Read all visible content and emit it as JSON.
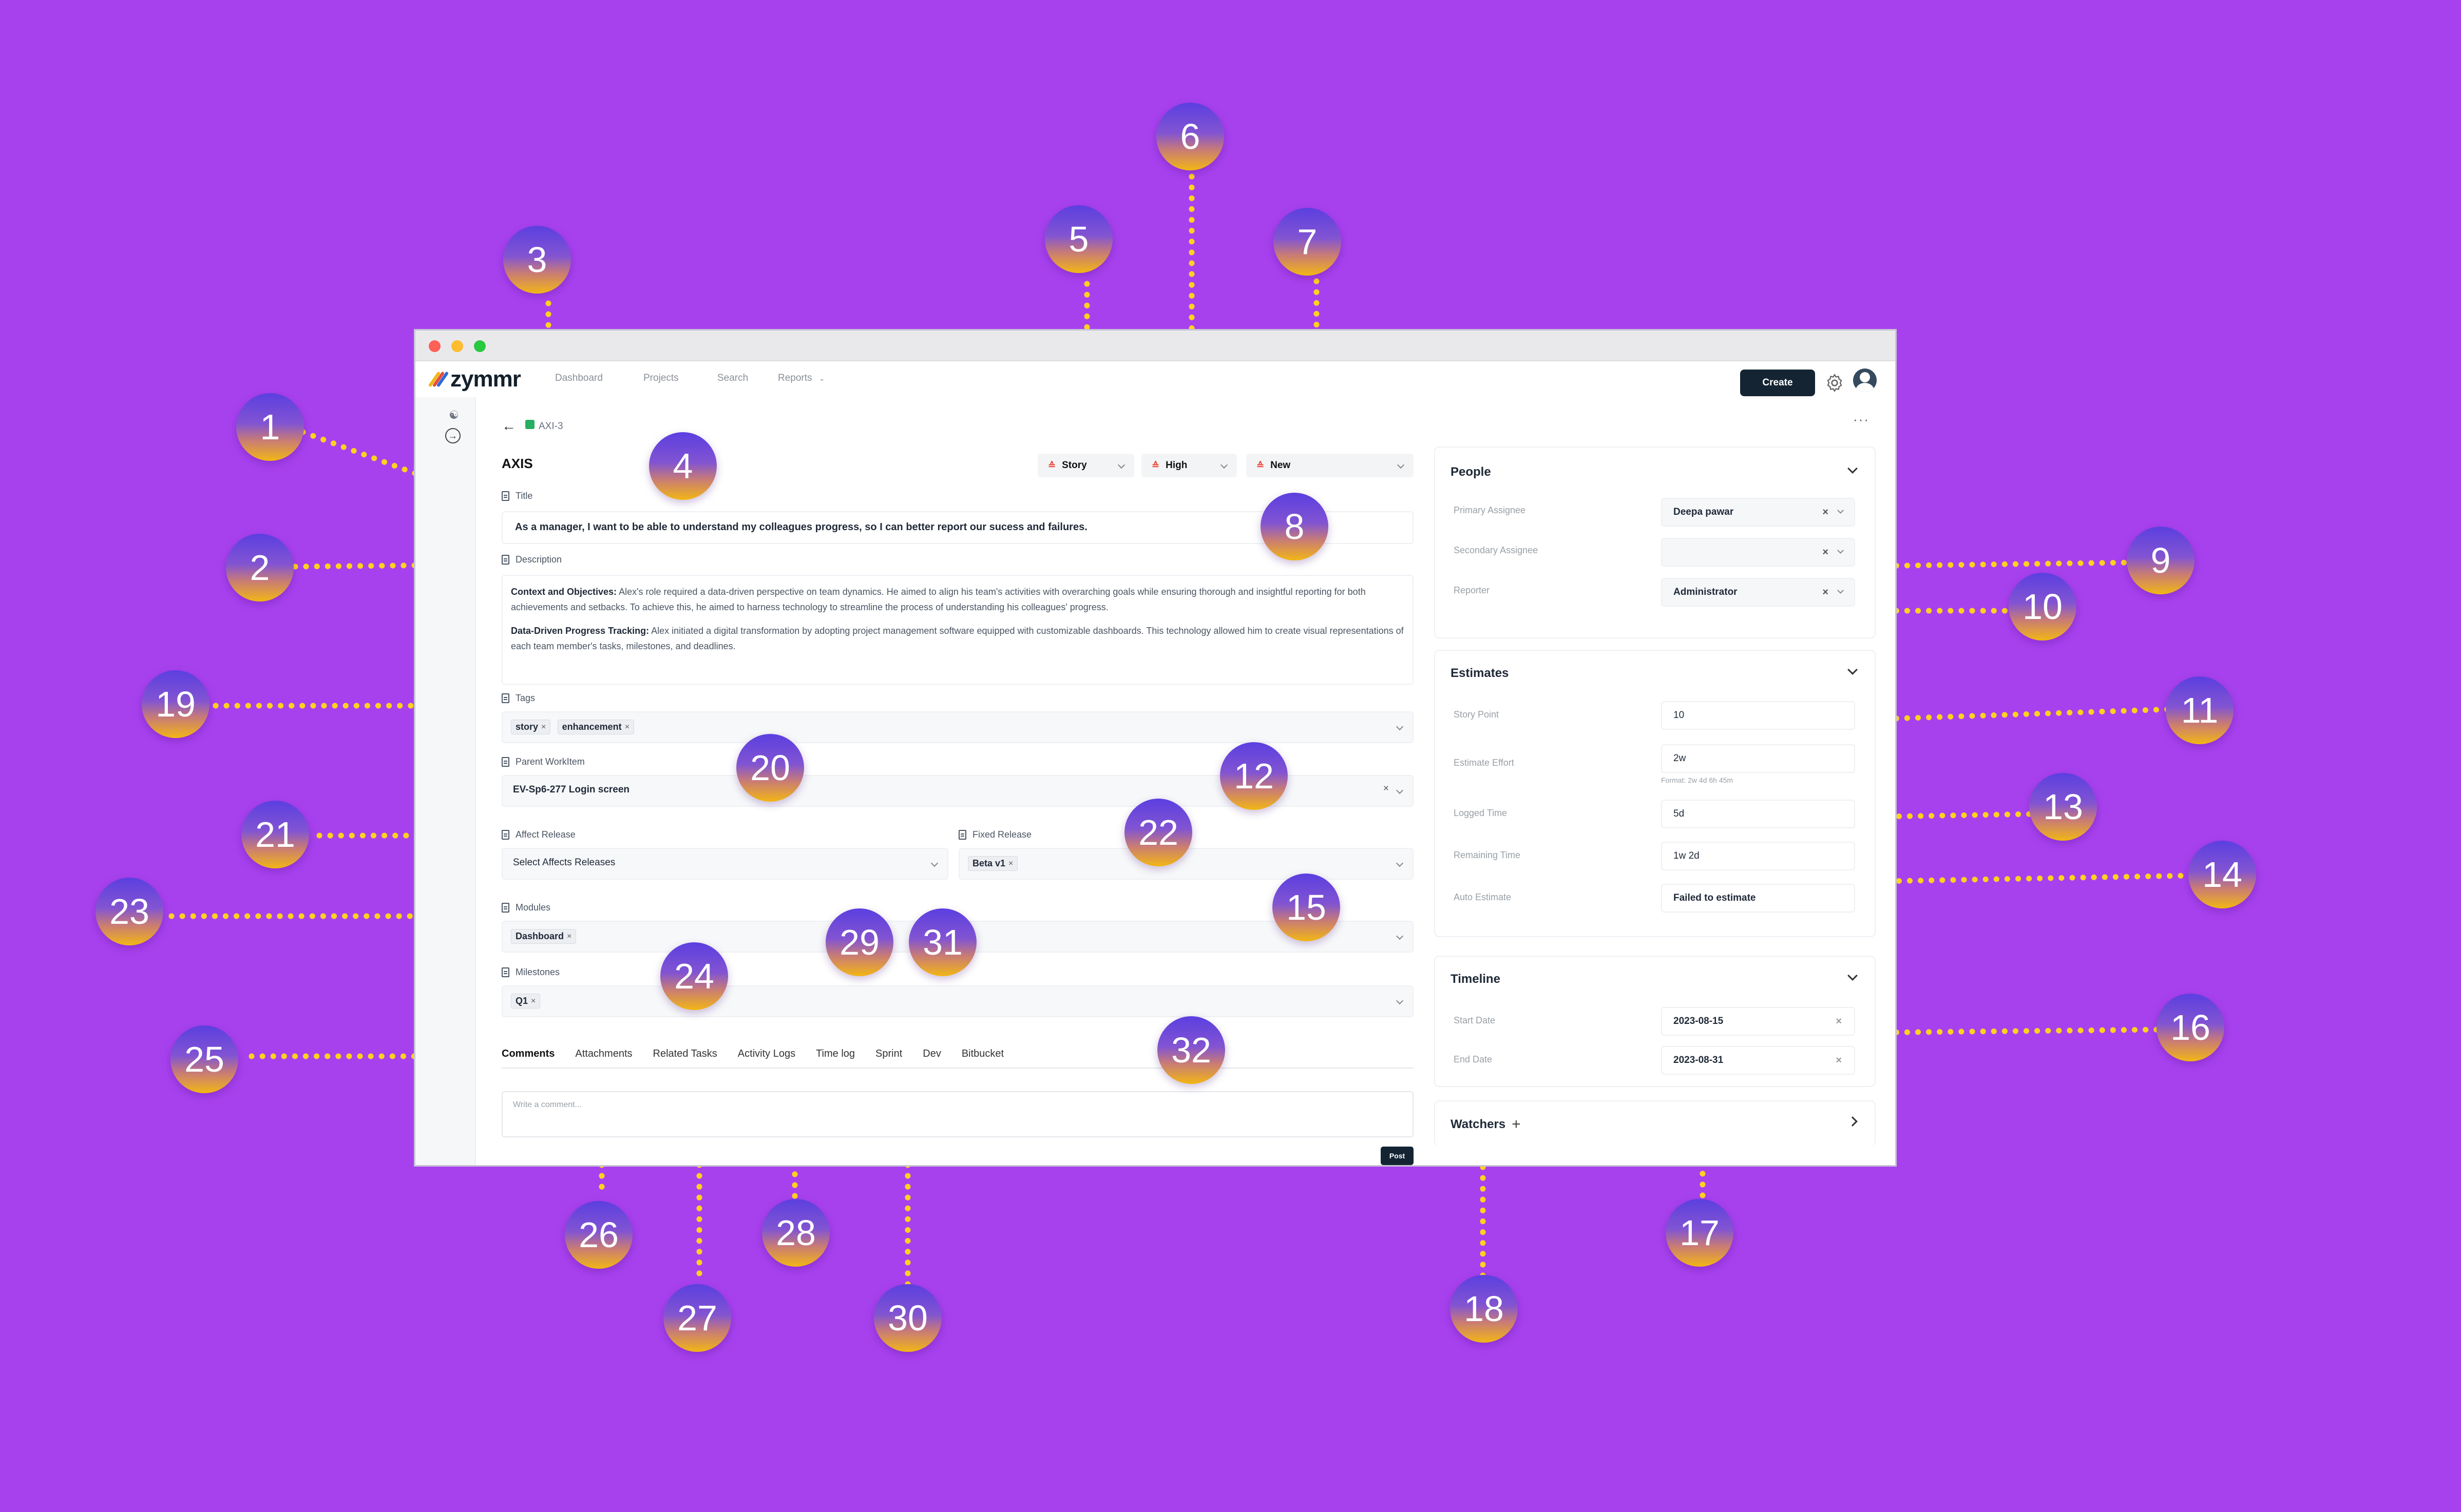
{
  "app": {
    "logo_text": "zymmr",
    "nav": [
      "Dashboard",
      "Projects",
      "Search",
      "Reports"
    ],
    "create_label": "Create"
  },
  "breadcrumb": {
    "item_id": "AXI-3"
  },
  "issue": {
    "project_name": "AXIS",
    "type": "Story",
    "priority": "High",
    "status": "New",
    "labels": {
      "title": "Title",
      "description": "Description",
      "tags": "Tags",
      "parent": "Parent WorkItem",
      "affect_release": "Affect Release",
      "fixed_release": "Fixed Release",
      "modules": "Modules",
      "milestones": "Milestones"
    },
    "title": "As a manager, I want to be able to understand my colleagues progress, so I can better report our sucess and failures.",
    "description": {
      "p1_head": "Context and Objectives:",
      "p1_body": "Alex's role required a data-driven perspective on team dynamics. He aimed to align his team's activities with overarching goals while ensuring thorough and insightful reporting for both achievements and setbacks. To achieve this, he aimed to harness technology to streamline the process of understanding his colleagues' progress.",
      "p2_head": "Data-Driven Progress Tracking:",
      "p2_body": "Alex initiated a digital transformation by adopting project management software equipped with customizable dashboards. This technology allowed him to create visual representations of each team member's tasks, milestones, and deadlines."
    },
    "tags": [
      "story",
      "enhancement"
    ],
    "parent_workitem": "EV-Sp6-277 Login screen",
    "affect_release_placeholder": "Select Affects Releases",
    "fixed_release": "Beta v1",
    "modules": [
      "Dashboard"
    ],
    "milestones": [
      "Q1"
    ]
  },
  "tabs": [
    "Comments",
    "Attachments",
    "Related Tasks",
    "Activity Logs",
    "Time log",
    "Sprint",
    "Dev",
    "Bitbucket"
  ],
  "comment": {
    "placeholder": "Write a comment...",
    "post_label": "Post"
  },
  "people": {
    "title": "People",
    "primary_assignee_label": "Primary Assignee",
    "primary_assignee": "Deepa pawar",
    "secondary_assignee_label": "Secondary Assignee",
    "secondary_assignee": "",
    "reporter_label": "Reporter",
    "reporter": "Administrator"
  },
  "estimates": {
    "title": "Estimates",
    "story_point_label": "Story Point",
    "story_point": "10",
    "estimate_effort_label": "Estimate Effort",
    "estimate_effort": "2w",
    "format_hint": "Format: 2w 4d 6h 45m",
    "logged_time_label": "Logged Time",
    "logged_time": "5d",
    "remaining_time_label": "Remaining Time",
    "remaining_time": "1w 2d",
    "auto_estimate_label": "Auto Estimate",
    "auto_estimate": "Failed to estimate"
  },
  "timeline": {
    "title": "Timeline",
    "start_label": "Start Date",
    "start_date": "2023-08-15",
    "end_label": "End Date",
    "end_date": "2023-08-31"
  },
  "watchers": {
    "title": "Watchers"
  },
  "annotations": [
    "1",
    "2",
    "3",
    "4",
    "5",
    "6",
    "7",
    "8",
    "9",
    "10",
    "11",
    "12",
    "13",
    "14",
    "15",
    "16",
    "17",
    "18",
    "19",
    "20",
    "21",
    "22",
    "23",
    "24",
    "25",
    "26",
    "27",
    "28",
    "29",
    "30",
    "31",
    "32"
  ],
  "colors": {
    "background": "#a741ee",
    "badge_top": "#5b3fe0",
    "badge_bottom": "#f2b615",
    "leader_dots": "#ffd21f",
    "primary_button": "#142433"
  }
}
